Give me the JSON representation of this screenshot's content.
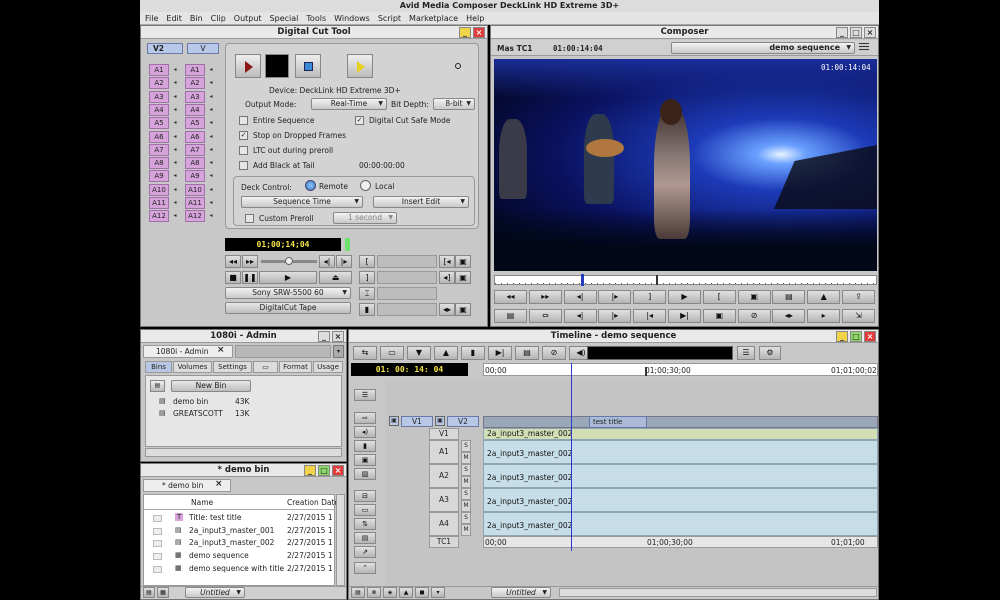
{
  "app": {
    "title": "Avid Media Composer DeckLink HD Extreme 3D+",
    "menu": [
      "File",
      "Edit",
      "Bin",
      "Clip",
      "Output",
      "Special",
      "Tools",
      "Windows",
      "Script",
      "Marketplace",
      "Help"
    ]
  },
  "digitalcut": {
    "title": "Digital Cut Tool",
    "track_sel": [
      "V2",
      "V"
    ],
    "record_tracks": [
      "A1",
      "A2",
      "A3",
      "A4",
      "A5",
      "A6",
      "A7",
      "A8",
      "A9",
      "A10",
      "A11",
      "A12"
    ],
    "source_tracks": [
      "A1",
      "A2",
      "A3",
      "A4"
    ],
    "device": "Device: DeckLink HD Extreme 3D+",
    "output_mode_label": "Output Mode:",
    "output_mode": "Real-Time",
    "bit_depth_label": "Bit Depth:",
    "bit_depth": "8-bit",
    "entire_sequence": "Entire Sequence",
    "safe_mode": "Digital Cut Safe Mode",
    "stop_dropped": "Stop on Dropped Frames",
    "ltc_out": "LTC out during preroll",
    "add_black": "Add Black at Tail",
    "black_tc": "00:00:00:00",
    "deck_control": "Deck Control:",
    "remote": "Remote",
    "local": "Local",
    "seq_time": "Sequence Time",
    "insert_edit": "Insert Edit",
    "custom_preroll": "Custom Preroll",
    "preroll_val": "1 second",
    "timecode": "01;00;14;04",
    "deck": "Sony SRW-5500 60",
    "tape": "DigitalCut Tape"
  },
  "composer": {
    "title": "Composer",
    "tc_label": "Mas TC1",
    "tc": "01:00:14:04",
    "sequence": "demo sequence",
    "overlay_tc": "01:00:14:04"
  },
  "project": {
    "title": "1080i - Admin",
    "tab_name": "1080i - Admin",
    "tabs": [
      "Bins",
      "Volumes",
      "Settings",
      "",
      "Format",
      "Usage"
    ],
    "new_bin": "New Bin",
    "bins": [
      {
        "name": "demo bin",
        "size": "43K"
      },
      {
        "name": "GREATSCOTT",
        "size": "13K"
      }
    ]
  },
  "bin": {
    "title": "* demo bin",
    "tab": "* demo bin",
    "col_name": "Name",
    "col_date": "Creation Date",
    "rows": [
      {
        "name": "Title: test title",
        "date": "2/27/2015 1"
      },
      {
        "name": "2a_input3_master_001",
        "date": "2/27/2015 1"
      },
      {
        "name": "2a_input3_master_002",
        "date": "2/27/2015 1"
      },
      {
        "name": "demo sequence",
        "date": "2/27/2015 1"
      },
      {
        "name": "demo sequence with title",
        "date": "2/27/2015 1"
      }
    ],
    "footer": "Untitled"
  },
  "timeline": {
    "title": "Timeline - demo sequence",
    "tc": "01: 00: 14: 04",
    "ruler": [
      "00;00",
      "01;00;30;00",
      "01;01;00;02"
    ],
    "tc_ruler": [
      "00;00",
      "01;00;30;00",
      "01;01;00"
    ],
    "src_tracks": [
      "V1"
    ],
    "rec_tracks": [
      "V2",
      "V1",
      "A1",
      "A2",
      "A3",
      "A4",
      "TC1"
    ],
    "title_clip": "test title",
    "clip_name": "2a_input3_master_002",
    "footer": "Untitled"
  }
}
